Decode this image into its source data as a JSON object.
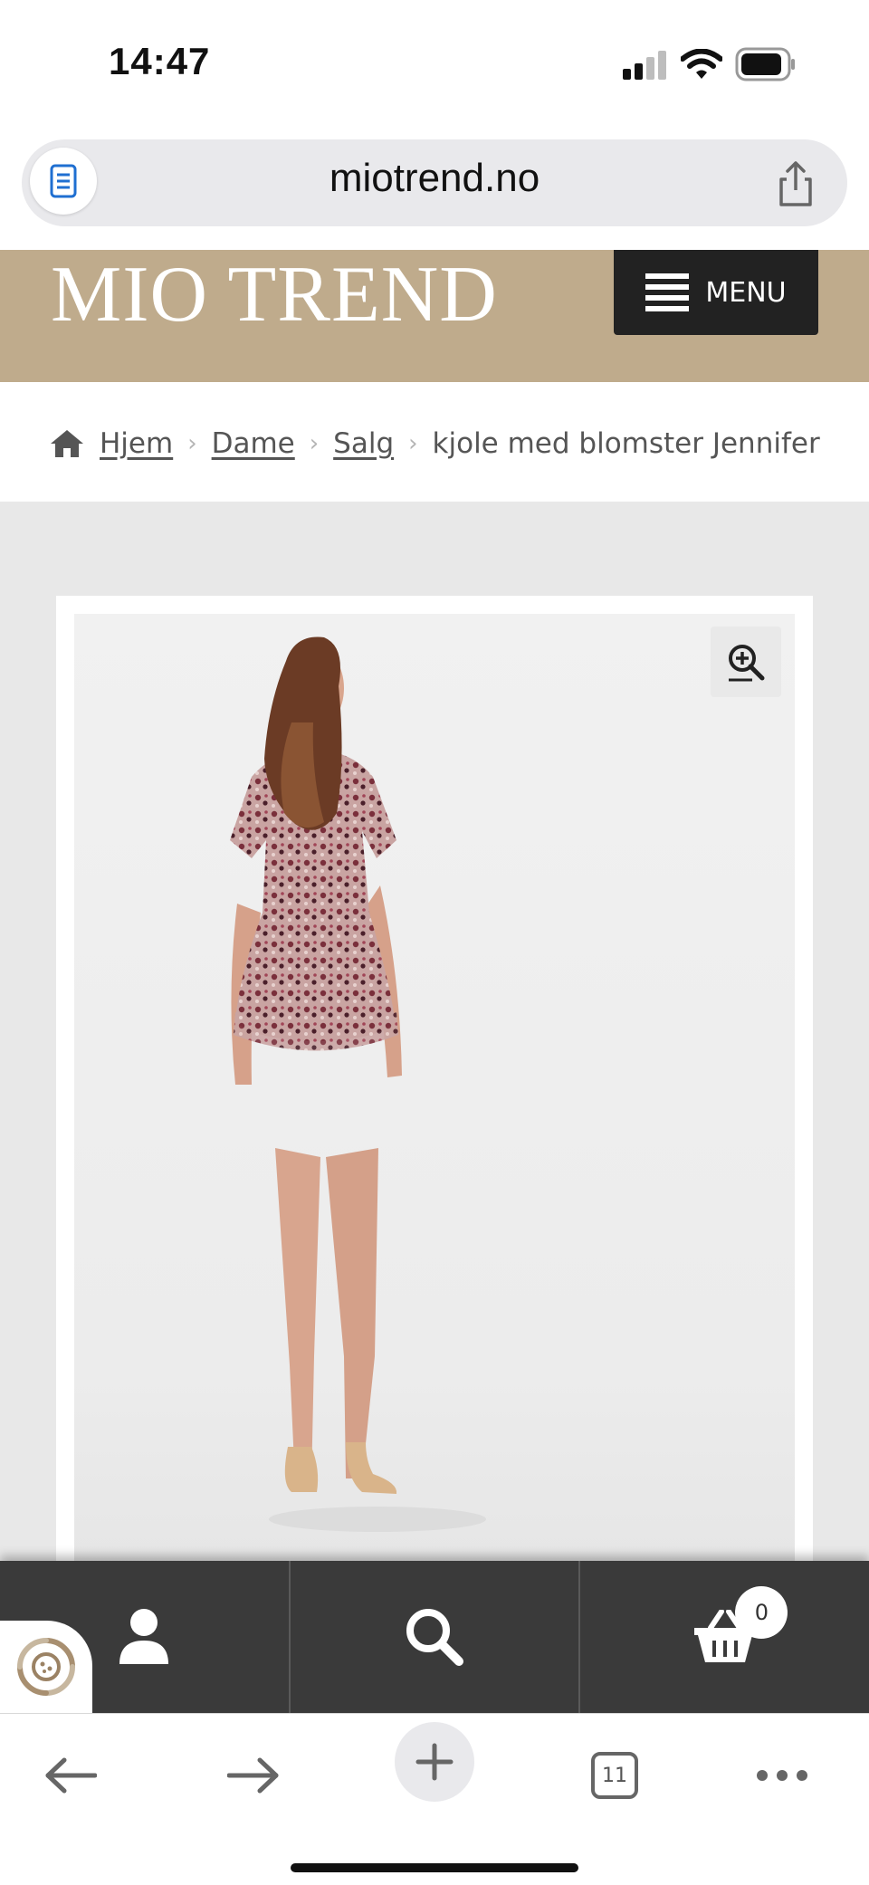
{
  "status_bar": {
    "time": "14:47",
    "signal": "signal-bars-icon",
    "wifi": "wifi-icon",
    "battery": "battery-icon"
  },
  "browser": {
    "url": "miotrend.no",
    "reader_icon": "reader-mode-icon",
    "share_icon": "share-icon"
  },
  "site_header": {
    "logo": "MIO TREND",
    "menu_label": "MENU",
    "background": "#bfab8c"
  },
  "breadcrumb": {
    "home": "Hjem",
    "level1": "Dame",
    "level2": "Salg",
    "current": "kjole med blomster Jennifer"
  },
  "product": {
    "image_alt": "kjole med blomster Jennifer",
    "zoom_icon": "zoom-in-icon"
  },
  "footer_bar": {
    "account_icon": "user-icon",
    "search_icon": "search-icon",
    "cart_icon": "basket-icon",
    "cart_count": "0",
    "background": "#3a3a3a"
  },
  "toolbar": {
    "back_icon": "back-arrow-icon",
    "forward_icon": "forward-arrow-icon",
    "new_tab_icon": "plus-icon",
    "tabs_count": "11",
    "more_icon": "more-dots-icon"
  }
}
